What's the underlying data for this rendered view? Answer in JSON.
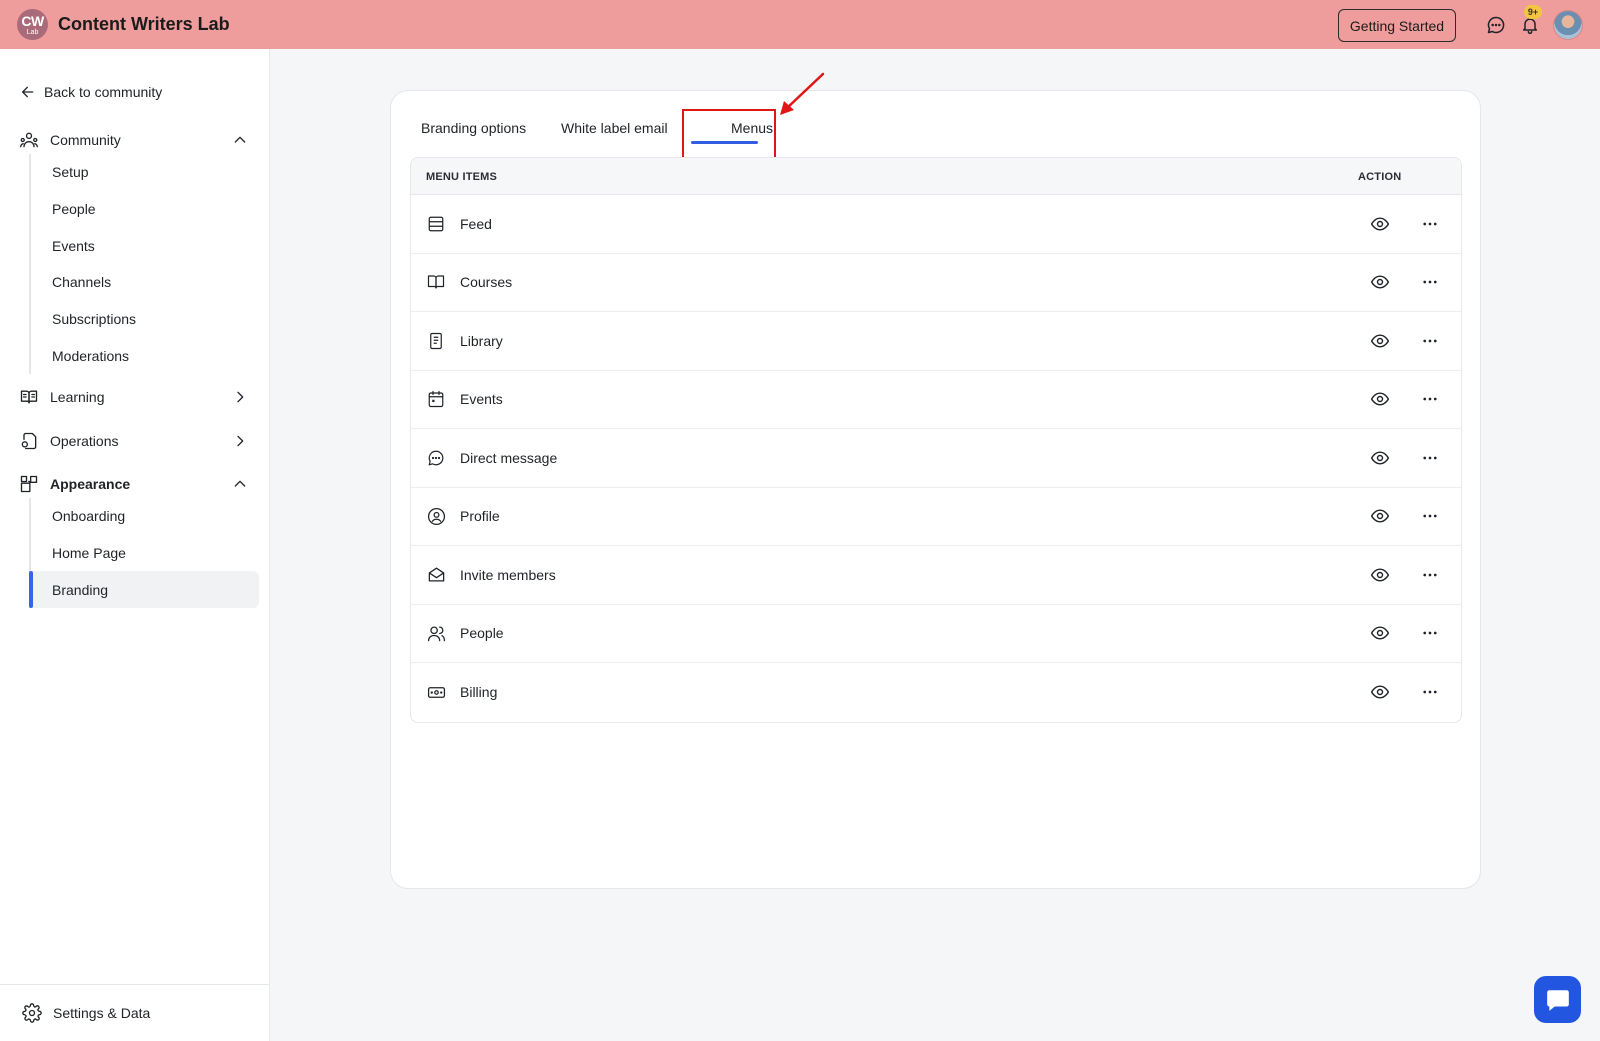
{
  "header": {
    "logo_main": "CW",
    "logo_sub": "Lab",
    "title": "Content Writers Lab",
    "getting_started": "Getting Started",
    "notification_badge": "9+"
  },
  "sidebar": {
    "back": "Back to community",
    "sections": {
      "community": "Community",
      "learning": "Learning",
      "operations": "Operations",
      "appearance": "Appearance"
    },
    "community_items": [
      "Setup",
      "People",
      "Events",
      "Channels",
      "Subscriptions",
      "Moderations"
    ],
    "appearance_items": [
      "Onboarding",
      "Home Page",
      "Branding"
    ],
    "active_item": "Branding",
    "settings": "Settings & Data"
  },
  "tabs": [
    "Branding options",
    "White label email",
    "Menus"
  ],
  "active_tab": "Menus",
  "table": {
    "header_items": "MENU ITEMS",
    "header_action": "ACTION",
    "rows": [
      {
        "label": "Feed",
        "icon": "feed-icon"
      },
      {
        "label": "Courses",
        "icon": "book-icon"
      },
      {
        "label": "Library",
        "icon": "library-icon"
      },
      {
        "label": "Events",
        "icon": "calendar-icon"
      },
      {
        "label": "Direct message",
        "icon": "message-icon"
      },
      {
        "label": "Profile",
        "icon": "profile-icon"
      },
      {
        "label": "Invite members",
        "icon": "envelope-icon"
      },
      {
        "label": "People",
        "icon": "people-icon"
      },
      {
        "label": "Billing",
        "icon": "billing-icon"
      }
    ]
  },
  "colors": {
    "topbar": "#ee9c9c",
    "accent": "#2f5fe0",
    "highlight": "#e01616"
  }
}
